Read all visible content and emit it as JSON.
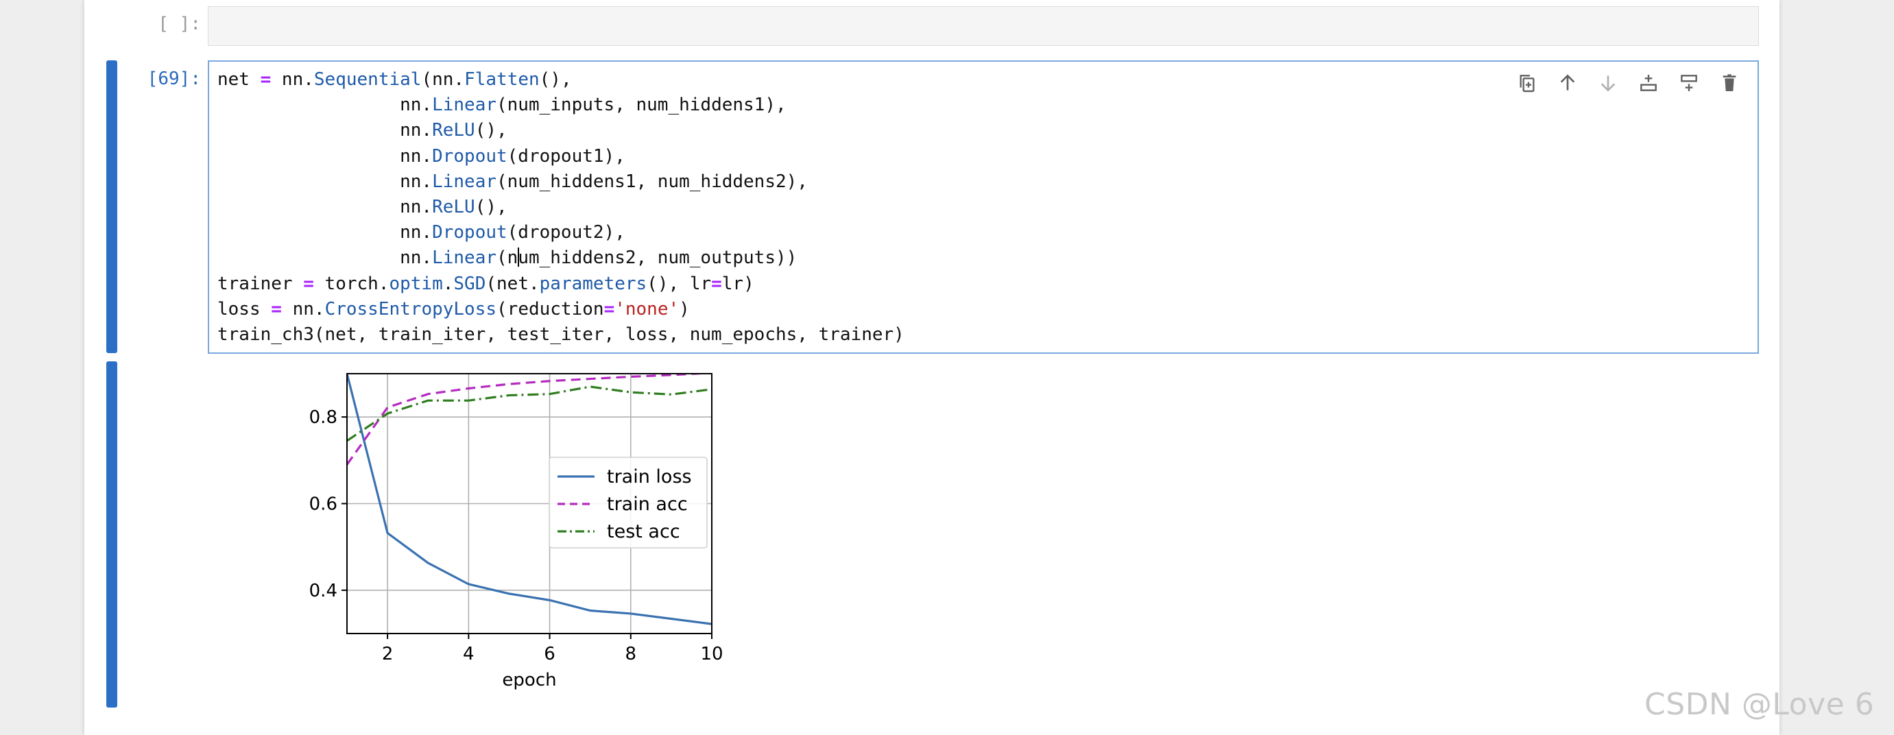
{
  "cells": [
    {
      "prompt": "[ ]:"
    },
    {
      "prompt": "[69]:"
    }
  ],
  "toolbar": {
    "icons": [
      "duplicate-icon",
      "move-up-icon",
      "move-down-icon",
      "insert-below-icon",
      "insert-above-icon",
      "delete-icon"
    ]
  },
  "code_lines": [
    [
      [
        "net ",
        ""
      ],
      [
        "=",
        "op"
      ],
      [
        " nn.",
        ""
      ],
      [
        "Sequential",
        "fn"
      ],
      [
        "(nn.",
        ""
      ],
      [
        "Flatten",
        "fn"
      ],
      [
        "(),",
        ""
      ]
    ],
    [
      [
        "                 nn.",
        ""
      ],
      [
        "Linear",
        "fn"
      ],
      [
        "(num_inputs, num_hiddens1),",
        ""
      ]
    ],
    [
      [
        "                 nn.",
        ""
      ],
      [
        "ReLU",
        "fn"
      ],
      [
        "(),",
        ""
      ]
    ],
    [
      [
        "                 nn.",
        ""
      ],
      [
        "Dropout",
        "fn"
      ],
      [
        "(dropout1),",
        ""
      ]
    ],
    [
      [
        "                 nn.",
        ""
      ],
      [
        "Linear",
        "fn"
      ],
      [
        "(num_hiddens1, num_hiddens2),",
        ""
      ]
    ],
    [
      [
        "                 nn.",
        ""
      ],
      [
        "ReLU",
        "fn"
      ],
      [
        "(),",
        ""
      ]
    ],
    [
      [
        "                 nn.",
        ""
      ],
      [
        "Dropout",
        "fn"
      ],
      [
        "(dropout2),",
        ""
      ]
    ],
    [
      [
        "                 nn.",
        ""
      ],
      [
        "Linear",
        "fn"
      ],
      [
        "(n",
        ""
      ],
      [
        "",
        "cursor"
      ],
      [
        "um_hiddens2, num_outputs))",
        ""
      ]
    ],
    [
      [
        "trainer ",
        ""
      ],
      [
        "=",
        "op"
      ],
      [
        " torch.",
        ""
      ],
      [
        "optim",
        "fn"
      ],
      [
        ".",
        ""
      ],
      [
        "SGD",
        "fn"
      ],
      [
        "(net.",
        ""
      ],
      [
        "parameters",
        "fn"
      ],
      [
        "(), lr",
        ""
      ],
      [
        "=",
        "op"
      ],
      [
        "lr)",
        ""
      ]
    ],
    [
      [
        "loss ",
        ""
      ],
      [
        "=",
        "op"
      ],
      [
        " nn.",
        ""
      ],
      [
        "CrossEntropyLoss",
        "fn"
      ],
      [
        "(reduction",
        ""
      ],
      [
        "=",
        "op"
      ],
      [
        "'none'",
        "str"
      ],
      [
        ")",
        ""
      ]
    ],
    [
      [
        "train_ch3(net, train_iter, test_iter, loss, num_epochs, trainer)",
        ""
      ]
    ]
  ],
  "chart_data": {
    "type": "line",
    "xlabel": "epoch",
    "ylabel": "",
    "xlim": [
      1,
      10
    ],
    "ylim": [
      0.3,
      0.9
    ],
    "xticks": [
      2,
      4,
      6,
      8,
      10
    ],
    "yticks": [
      0.4,
      0.6,
      0.8
    ],
    "grid": true,
    "legend_position": "center-right",
    "x": [
      1,
      2,
      3,
      4,
      5,
      6,
      7,
      8,
      9,
      10
    ],
    "series": [
      {
        "name": "train loss",
        "color": "#3a72b0",
        "style": "solid",
        "values": [
          0.9,
          0.532,
          0.463,
          0.414,
          0.392,
          0.377,
          0.353,
          0.346,
          0.334,
          0.322
        ]
      },
      {
        "name": "train acc",
        "color": "#b52bc0",
        "style": "dashed",
        "values": [
          0.69,
          0.822,
          0.853,
          0.866,
          0.876,
          0.883,
          0.888,
          0.893,
          0.897,
          0.902
        ]
      },
      {
        "name": "test acc",
        "color": "#2f7d1f",
        "style": "dashdot",
        "values": [
          0.745,
          0.808,
          0.838,
          0.838,
          0.85,
          0.853,
          0.87,
          0.857,
          0.852,
          0.864
        ]
      }
    ]
  },
  "watermark": "CSDN @Love 6"
}
